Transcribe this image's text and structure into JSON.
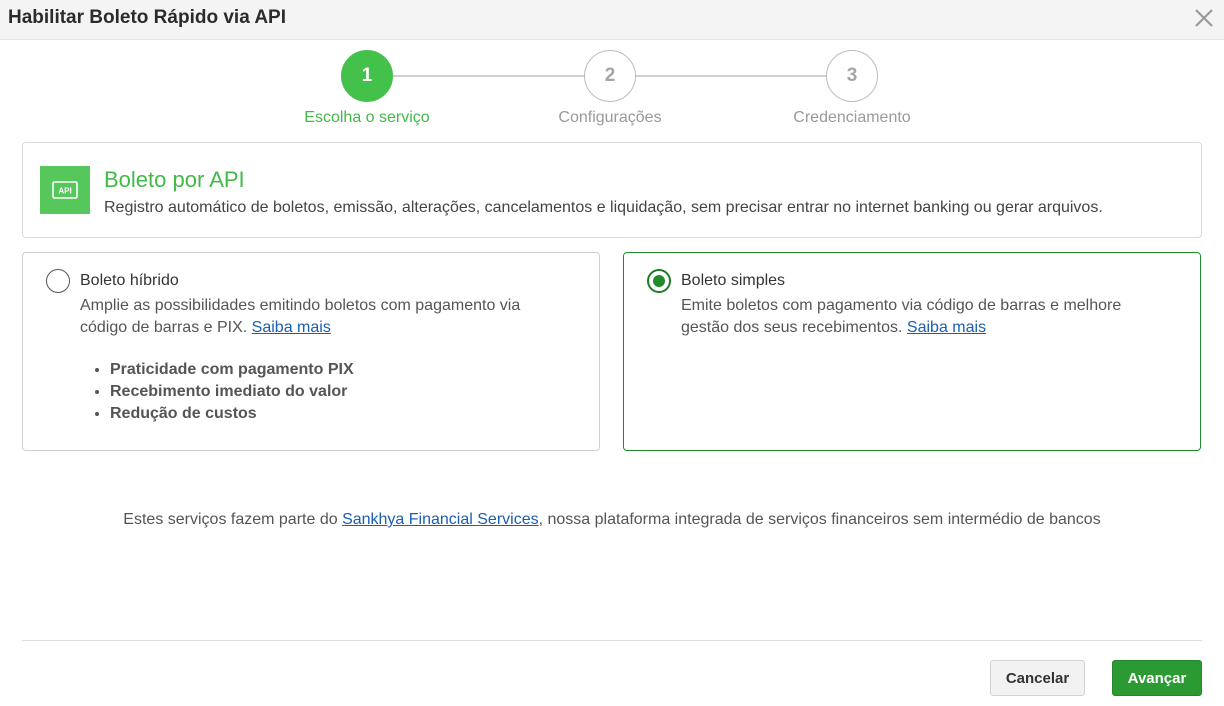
{
  "dialog": {
    "title": "Habilitar Boleto Rápido via API",
    "close_icon": "close-icon"
  },
  "stepper": {
    "steps": [
      {
        "number": "1",
        "label": "Escolha o serviço",
        "state": "active"
      },
      {
        "number": "2",
        "label": "Configurações",
        "state": "inactive"
      },
      {
        "number": "3",
        "label": "Credenciamento",
        "state": "inactive"
      }
    ],
    "active_color": "#43c14b"
  },
  "service": {
    "icon": "api-icon",
    "icon_text": "API",
    "title": "Boleto por API",
    "description": "Registro automático de boletos, emissão, alterações, cancelamentos e liquidação, sem precisar entrar no internet banking ou gerar arquivos."
  },
  "options": [
    {
      "title": "Boleto híbrido",
      "description_1": "Amplie as possibilidades emitindo boletos com pagamento via",
      "description_2": "código de barras e PIX.",
      "link": "Saiba mais",
      "selected": false,
      "bullets": [
        "Praticidade com pagamento PIX",
        "Recebimento imediato do valor",
        "Redução de custos"
      ]
    },
    {
      "title": "Boleto simples",
      "description_1": "Emite boletos com pagamento via código de barras e melhore",
      "description_2": "gestão dos seus recebimentos.",
      "link": "Saiba mais",
      "selected": true
    }
  ],
  "note": {
    "prefix": "Estes serviços fazem parte do ",
    "link": "Sankhya Financial Services",
    "suffix": ", nossa plataforma integrada de serviços financeiros sem intermédio de bancos"
  },
  "buttons": {
    "cancel": "Cancelar",
    "next": "Avançar"
  },
  "colors": {
    "brand_green": "#43b94a",
    "primary_button": "#2b9a33",
    "link": "#1a5fb4"
  }
}
